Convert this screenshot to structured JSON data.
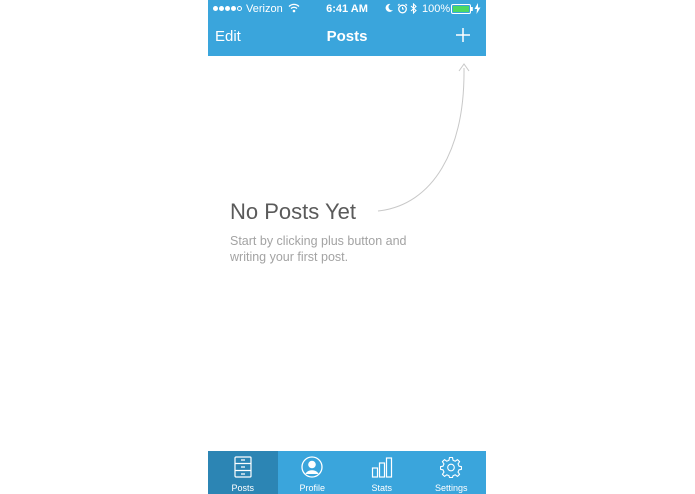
{
  "status_bar": {
    "carrier": "Verizon",
    "time": "6:41 AM",
    "battery": "100%"
  },
  "nav": {
    "left_button": "Edit",
    "title": "Posts",
    "right_icon": "plus-icon"
  },
  "empty_state": {
    "title": "No Posts Yet",
    "description": "Start by clicking plus button and writing your first post."
  },
  "tabs": [
    {
      "label": "Posts",
      "icon": "posts-icon",
      "active": true
    },
    {
      "label": "Profile",
      "icon": "profile-icon",
      "active": false
    },
    {
      "label": "Stats",
      "icon": "stats-icon",
      "active": false
    },
    {
      "label": "Settings",
      "icon": "gear-icon",
      "active": false
    }
  ],
  "colors": {
    "header": "#3aa5dc",
    "active_tab": "#2c85b4",
    "title_text": "#5a5a5a",
    "body_text": "#a3a3a3"
  }
}
